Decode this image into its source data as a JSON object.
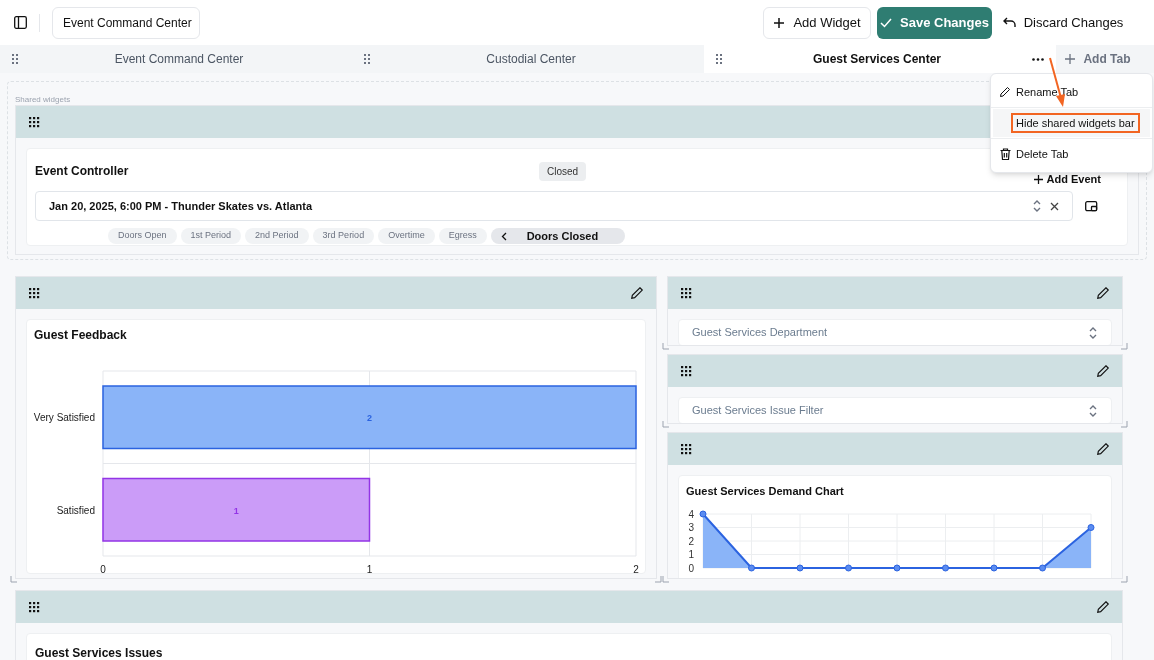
{
  "top_bar": {
    "dashboard_name": "Event Command Center",
    "buttons": [
      {
        "kind": "add",
        "label": "Add Widget"
      },
      {
        "kind": "save",
        "label": "Save Changes"
      },
      {
        "kind": "discard",
        "label": "Discard Changes"
      }
    ]
  },
  "tabs": [
    {
      "label": "Event Command Center",
      "selected": false
    },
    {
      "label": "Custodial Center",
      "selected": false
    },
    {
      "label": "Guest Services Center",
      "selected": true
    }
  ],
  "add_tab": "Add Tab",
  "tab_menu": {
    "items": [
      {
        "kind": "rename",
        "label": "Rename Tab",
        "highlighted": false
      },
      {
        "kind": "hide",
        "label": "Hide shared widgets bar",
        "highlighted": true
      },
      {
        "kind": "delete",
        "label": "Delete Tab",
        "highlighted": false
      }
    ]
  },
  "shared_widgets": {
    "label": "Shared widgets",
    "controller": {
      "title": "Event Controller",
      "status": "Closed",
      "add_event": "Add Event",
      "event": "Jan 20, 2025, 6:00 PM - Thunder Skates vs. Atlanta",
      "stages": [
        {
          "label": "Doors Open",
          "selected": false
        },
        {
          "label": "1st Period",
          "selected": false
        },
        {
          "label": "2nd Period",
          "selected": false
        },
        {
          "label": "3rd Period",
          "selected": false
        },
        {
          "label": "Overtime",
          "selected": false
        },
        {
          "label": "Egress",
          "selected": false
        },
        {
          "label": "Doors Closed",
          "selected": true
        }
      ]
    }
  },
  "widgets": [
    {
      "kind": "bar_chart",
      "title": "Guest Feedback",
      "chart_data": {
        "type": "bar",
        "orientation": "horizontal",
        "categories": [
          "Very Satisfied",
          "Satisfied"
        ],
        "values": [
          2,
          1
        ],
        "xlim": [
          0,
          2
        ],
        "xticks": [
          0,
          1,
          2
        ],
        "data_labels": true
      }
    },
    {
      "kind": "select",
      "placeholder": "Guest Services Department"
    },
    {
      "kind": "select",
      "placeholder": "Guest Services Issue Filter"
    },
    {
      "kind": "area_chart",
      "title": "Guest Services Demand Chart",
      "chart_data": {
        "type": "area",
        "values": [
          4,
          0,
          0,
          0,
          0,
          0,
          0,
          0,
          3
        ],
        "ylim": [
          0,
          4
        ],
        "grid": true,
        "yticks": [
          0,
          1,
          2,
          3,
          4
        ]
      }
    },
    {
      "kind": "title_only",
      "title": "Guest Services Issues"
    }
  ]
}
